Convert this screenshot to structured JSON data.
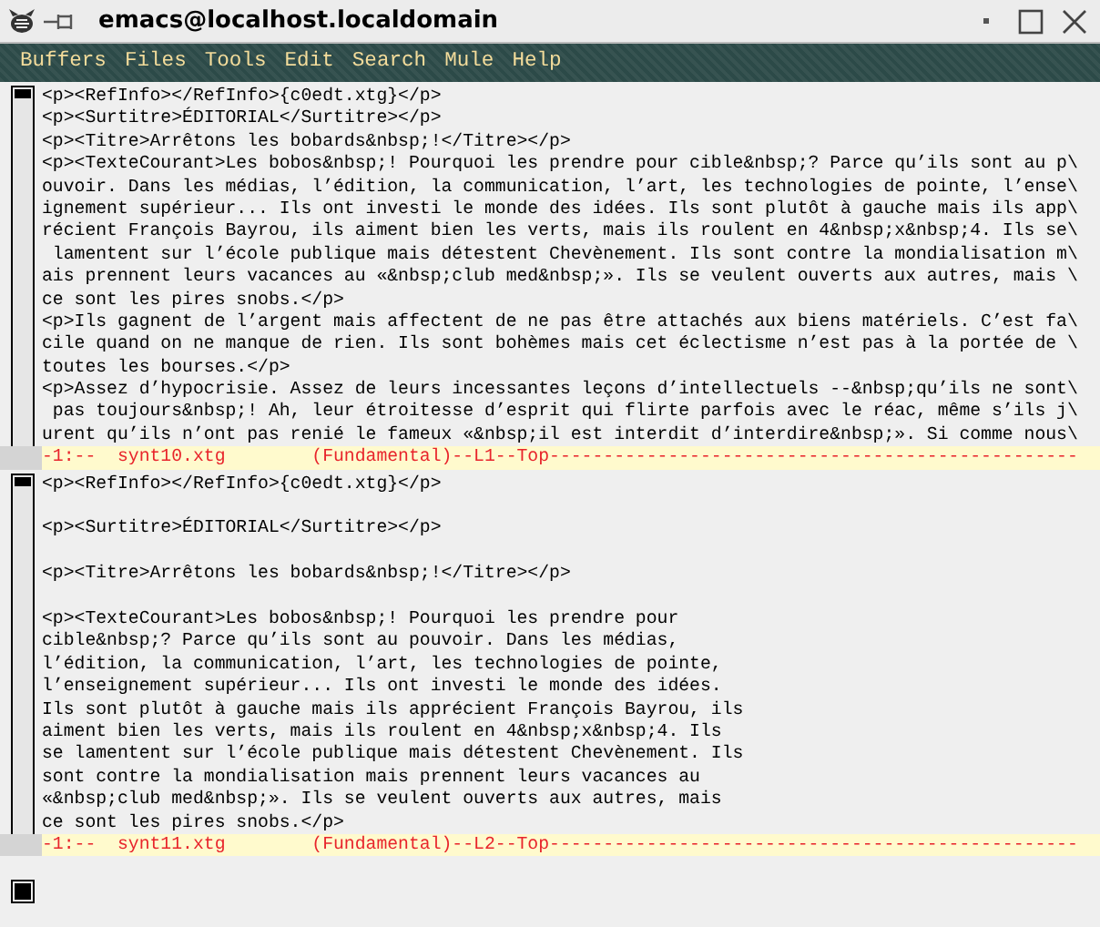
{
  "window": {
    "title": "emacs@localhost.localdomain"
  },
  "menu": [
    "Buffers",
    "Files",
    "Tools",
    "Edit",
    "Search",
    "Mule",
    "Help"
  ],
  "panes": [
    {
      "lines": [
        {
          "kind": "text",
          "text": "<p><RefInfo></RefInfo>{c0edt.xtg}</p>"
        },
        {
          "kind": "text",
          "text": "<p><Surtitre>ÉDITORIAL</Surtitre></p>"
        },
        {
          "kind": "text",
          "text": "<p><Titre>Arrêtons les bobards&nbsp;!</Titre></p>"
        },
        {
          "kind": "text",
          "text": "<p><TexteCourant>Les bobos&nbsp;! Pourquoi les prendre pour cible&nbsp;? Parce qu’ils sont au p\\"
        },
        {
          "kind": "text",
          "text": "ouvoir. Dans les médias, l’édition, la communication, l’art, les technologies de pointe, l’ense\\"
        },
        {
          "kind": "text",
          "text": "ignement supérieur... Ils ont investi le monde des idées. Ils sont plutôt à gauche mais ils app\\"
        },
        {
          "kind": "text",
          "text": "récient François Bayrou, ils aiment bien les verts, mais ils roulent en 4&nbsp;x&nbsp;4. Ils se\\"
        },
        {
          "kind": "text",
          "text": " lamentent sur l’école publique mais détestent Chevènement. Ils sont contre la mondialisation m\\"
        },
        {
          "kind": "text",
          "text": "ais prennent leurs vacances au «&nbsp;club med&nbsp;». Ils se veulent ouverts aux autres, mais \\"
        },
        {
          "kind": "text",
          "text": "ce sont les pires snobs.</p>"
        },
        {
          "kind": "text",
          "text": "<p>Ils gagnent de l’argent mais affectent de ne pas être attachés aux biens matériels. C’est fa\\"
        },
        {
          "kind": "text",
          "text": "cile quand on ne manque de rien. Ils sont bohèmes mais cet éclectisme n’est pas à la portée de \\"
        },
        {
          "kind": "text",
          "text": "toutes les bourses.</p>"
        },
        {
          "kind": "text",
          "text": "<p>Assez d’hypocrisie. Assez de leurs incessantes leçons d’intellectuels --&nbsp;qu’ils ne sont\\"
        },
        {
          "kind": "text",
          "text": " pas toujours&nbsp;! Ah, leur étroitesse d’esprit qui flirte parfois avec le réac, même s’ils j\\"
        },
        {
          "kind": "text",
          "text": "urent qu’ils n’ont pas renié le fameux «&nbsp;il est interdit d’interdire&nbsp;». Si comme nous\\"
        }
      ],
      "mode_line": "-1:--  synt10.xtg        (Fundamental)--L1--Top-------------------------------------------------"
    },
    {
      "lines": [
        {
          "kind": "text",
          "text": "<p><RefInfo></RefInfo>{c0edt.xtg}</p>"
        },
        {
          "kind": "blank"
        },
        {
          "kind": "text",
          "text": "<p><Surtitre>ÉDITORIAL</Surtitre></p>"
        },
        {
          "kind": "blank"
        },
        {
          "kind": "text",
          "text": "<p><Titre>Arrêtons les bobards&nbsp;!</Titre></p>"
        },
        {
          "kind": "blank"
        },
        {
          "kind": "text",
          "text": "<p><TexteCourant>Les bobos&nbsp;! Pourquoi les prendre pour"
        },
        {
          "kind": "text",
          "text": "cible&nbsp;? Parce qu’ils sont au pouvoir. Dans les médias,"
        },
        {
          "kind": "text",
          "text": "l’édition, la communication, l’art, les technologies de pointe,"
        },
        {
          "kind": "text",
          "text": "l’enseignement supérieur... Ils ont investi le monde des idées."
        },
        {
          "kind": "text",
          "text": "Ils sont plutôt à gauche mais ils apprécient François Bayrou, ils"
        },
        {
          "kind": "text",
          "text": "aiment bien les verts, mais ils roulent en 4&nbsp;x&nbsp;4. Ils"
        },
        {
          "kind": "text",
          "text": "se lamentent sur l’école publique mais détestent Chevènement. Ils"
        },
        {
          "kind": "text",
          "text": "sont contre la mondialisation mais prennent leurs vacances au"
        },
        {
          "kind": "text",
          "text": "«&nbsp;club med&nbsp;». Ils se veulent ouverts aux autres, mais"
        },
        {
          "kind": "text",
          "text": "ce sont les pires snobs.</p>"
        }
      ],
      "mode_line": "-1:--  synt11.xtg        (Fundamental)--L2--Top-------------------------------------------------"
    }
  ]
}
